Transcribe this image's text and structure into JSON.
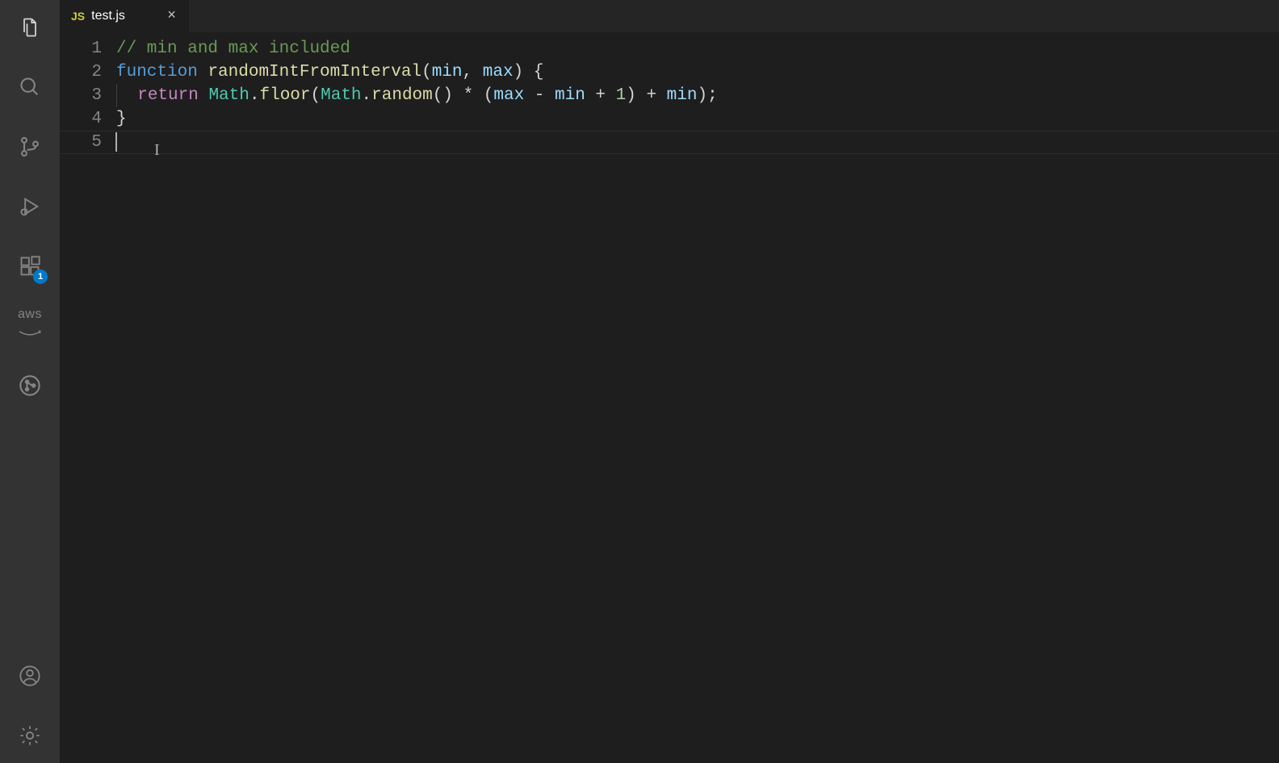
{
  "activityBar": {
    "top": [
      "explorer",
      "search",
      "source-control",
      "run-debug",
      "extensions",
      "aws",
      "git-graph"
    ],
    "bottom": [
      "account",
      "settings"
    ],
    "extensionsBadge": "1",
    "awsLabel": "aws"
  },
  "tabs": [
    {
      "icon": "JS",
      "label": "test.js",
      "active": true
    }
  ],
  "editor": {
    "lineNumbers": [
      "1",
      "2",
      "3",
      "4",
      "5"
    ],
    "code": {
      "l1_comment": "// min and max included",
      "l2_function": "function",
      "l2_name": "randomIntFromInterval",
      "l2_p1": "min",
      "l2_p2": "max",
      "l2_open": "(",
      "l2_comma": ", ",
      "l2_close_brace": ") {",
      "l3_return": "return",
      "l3_math1": "Math",
      "l3_floor": "floor",
      "l3_math2": "Math",
      "l3_random": "random",
      "l3_max": "max",
      "l3_min1": "min",
      "l3_one": "1",
      "l3_min2": "min",
      "l3_p1": ".",
      "l3_p2": "(",
      "l3_p3": ".",
      "l3_p4": "() * (",
      "l3_p5": " - ",
      "l3_p6": " + ",
      "l3_p7": ") + ",
      "l3_p8": ");",
      "l4_brace": "}"
    }
  }
}
